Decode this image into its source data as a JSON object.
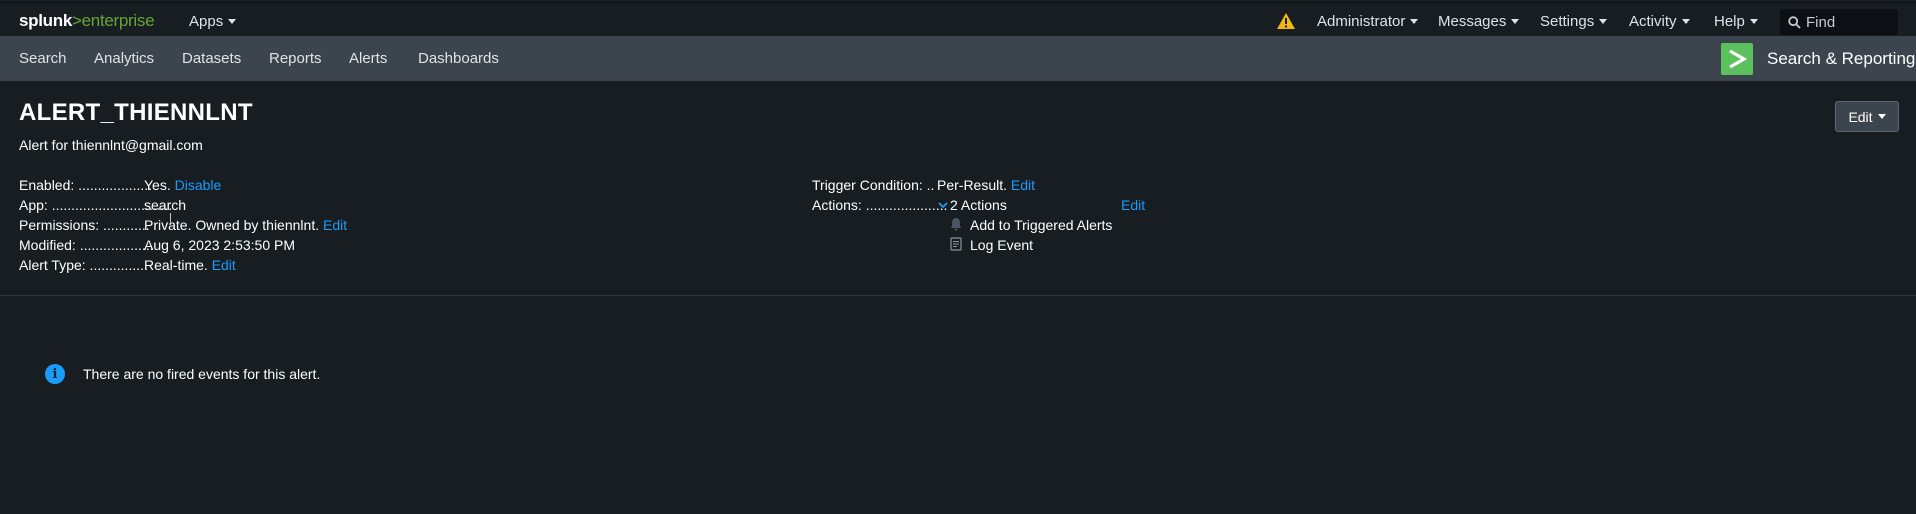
{
  "top": {
    "logo_main": "splunk",
    "logo_sep": ">",
    "logo_product": "enterprise",
    "apps": "Apps",
    "administrator": "Administrator",
    "messages": "Messages",
    "settings": "Settings",
    "activity": "Activity",
    "help": "Help",
    "find_placeholder": "Find",
    "warning_color": "#f1b813"
  },
  "nav": {
    "items": [
      "Search",
      "Analytics",
      "Datasets",
      "Reports",
      "Alerts",
      "Dashboards"
    ],
    "app_title": "Search & Reporting"
  },
  "alert": {
    "title": "ALERT_THIENNLNT",
    "description": "Alert for thiennlnt@gmail.com",
    "edit_button": "Edit",
    "enabled_label": "Enabled: ...................",
    "enabled_value": "Yes.",
    "enabled_link": "Disable",
    "app_label": "App: ...............................",
    "app_value": "search",
    "permissions_label": "Permissions: ............",
    "permissions_value": "Private. Owned by thiennlnt.",
    "permissions_link": "Edit",
    "modified_label": "Modified: ...................",
    "modified_value": "Aug 6, 2023 2:53:50 PM",
    "alert_type_label": "Alert Type: ...............",
    "alert_type_value": "Real-time.",
    "alert_type_link": "Edit",
    "trigger_label": "Trigger Condition: ..",
    "trigger_value": "Per-Result.",
    "trigger_link": "Edit",
    "actions_label": "Actions: .....................",
    "actions_value": "2 Actions",
    "actions_link": "Edit",
    "action_items": [
      "Add to Triggered Alerts",
      "Log Event"
    ]
  },
  "message": {
    "text": "There are no fired events for this alert."
  },
  "colors": {
    "link": "#1a9cff",
    "accent": "#65a637",
    "app_icon": "#5cc05c"
  }
}
